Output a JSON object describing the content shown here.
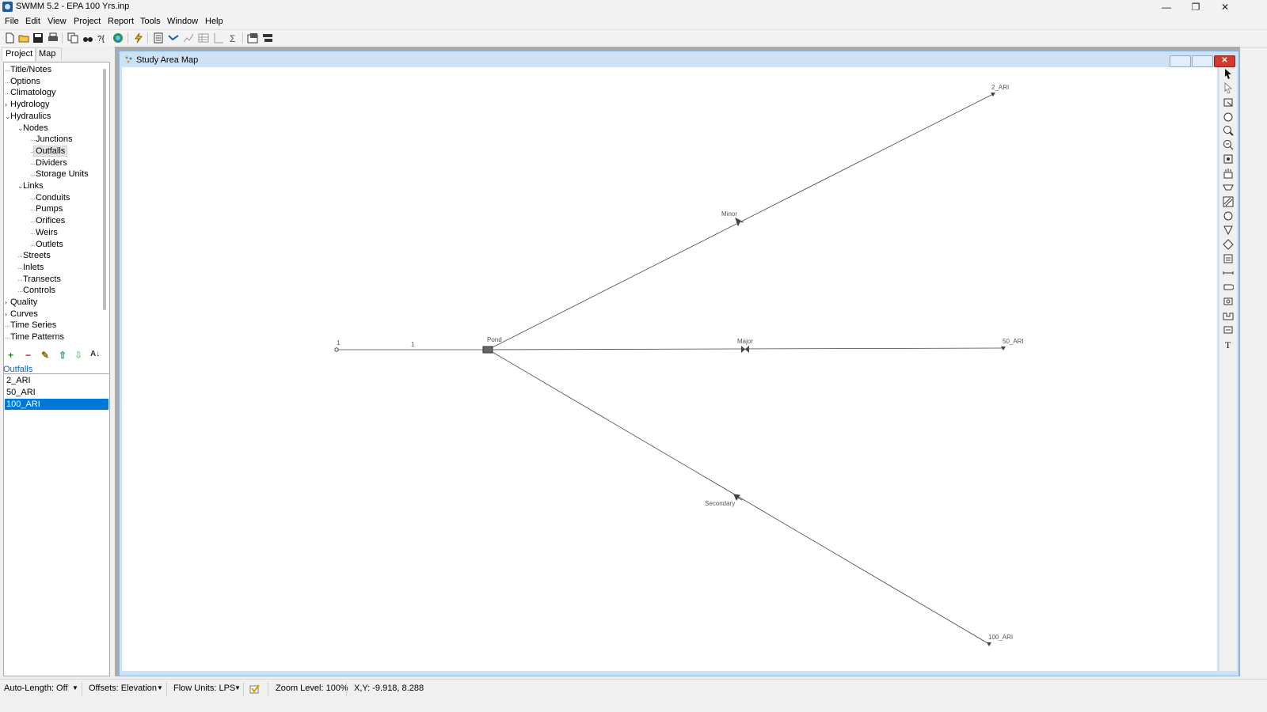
{
  "window": {
    "title": "SWMM 5.2 - EPA 100 Yrs.inp",
    "minimize": "—",
    "restore": "❐",
    "close": "✕"
  },
  "menu": [
    "File",
    "Edit",
    "View",
    "Project",
    "Report",
    "Tools",
    "Window",
    "Help"
  ],
  "left_panel": {
    "tabs": [
      "Project",
      "Map"
    ],
    "active_tab": "Project",
    "tree": [
      {
        "label": "Title/Notes",
        "level": 0,
        "expander": ""
      },
      {
        "label": "Options",
        "level": 0,
        "expander": ""
      },
      {
        "label": "Climatology",
        "level": 0,
        "expander": ""
      },
      {
        "label": "Hydrology",
        "level": 0,
        "expander": ">"
      },
      {
        "label": "Hydraulics",
        "level": 0,
        "expander": "v"
      },
      {
        "label": "Nodes",
        "level": 1,
        "expander": "v"
      },
      {
        "label": "Junctions",
        "level": 2,
        "expander": ""
      },
      {
        "label": "Outfalls",
        "level": 2,
        "expander": "",
        "selected": true
      },
      {
        "label": "Dividers",
        "level": 2,
        "expander": ""
      },
      {
        "label": "Storage Units",
        "level": 2,
        "expander": ""
      },
      {
        "label": "Links",
        "level": 1,
        "expander": "v"
      },
      {
        "label": "Conduits",
        "level": 2,
        "expander": ""
      },
      {
        "label": "Pumps",
        "level": 2,
        "expander": ""
      },
      {
        "label": "Orifices",
        "level": 2,
        "expander": ""
      },
      {
        "label": "Weirs",
        "level": 2,
        "expander": ""
      },
      {
        "label": "Outlets",
        "level": 2,
        "expander": ""
      },
      {
        "label": "Streets",
        "level": 1,
        "expander": ""
      },
      {
        "label": "Inlets",
        "level": 1,
        "expander": ""
      },
      {
        "label": "Transects",
        "level": 1,
        "expander": ""
      },
      {
        "label": "Controls",
        "level": 1,
        "expander": ""
      },
      {
        "label": "Quality",
        "level": 0,
        "expander": ">"
      },
      {
        "label": "Curves",
        "level": 0,
        "expander": ">"
      },
      {
        "label": "Time Series",
        "level": 0,
        "expander": ""
      },
      {
        "label": "Time Patterns",
        "level": 0,
        "expander": ""
      }
    ],
    "object_tools": {
      "add": "+",
      "delete": "−",
      "edit": "✎",
      "up": "⇧",
      "down": "⇩",
      "sort": "A↓"
    },
    "object_type": "Outfalls",
    "objects": [
      "2_ARI",
      "50_ARI",
      "100_ARI"
    ],
    "selected_object": "100_ARI"
  },
  "map_window": {
    "title": "Study Area Map",
    "labels": {
      "node_1": "1",
      "link_1": "1",
      "pond": "Pond",
      "minor": "Minor",
      "major": "Major",
      "secondary": "Secondary",
      "out_2": "2_ARI",
      "out_50": "50_ARI",
      "out_100": "100_ARI"
    }
  },
  "status": {
    "auto_length": "Auto-Length: Off",
    "offsets": "Offsets: Elevation",
    "flow_units": "Flow Units: LPS",
    "zoom": "Zoom Level: 100%",
    "xy": "X,Y: -9.918, 8.288"
  }
}
